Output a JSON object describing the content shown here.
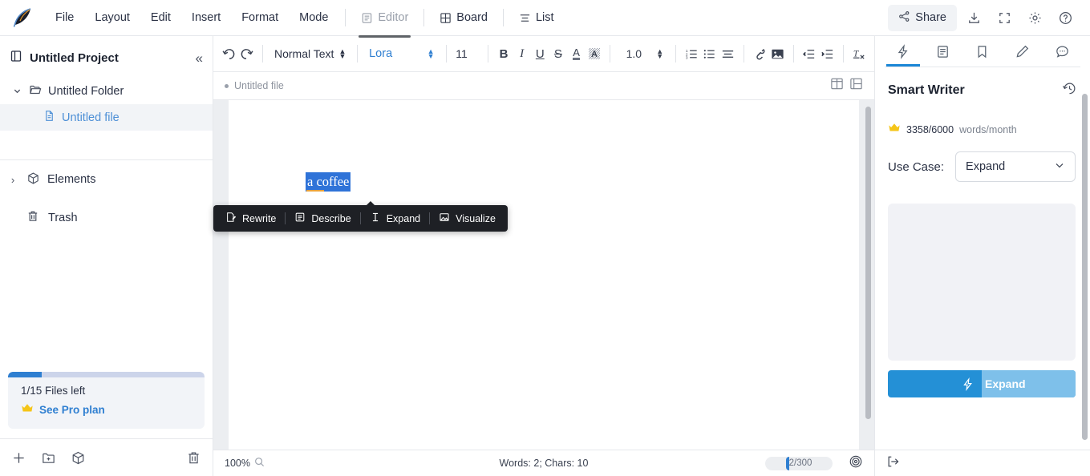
{
  "app": {
    "logo_icon": "quill-pen-logo"
  },
  "topbar": {
    "menus": [
      "File",
      "Layout",
      "Edit",
      "Insert",
      "Format",
      "Mode"
    ],
    "mode_tabs": [
      {
        "label": "Editor",
        "icon": "document-outline-icon",
        "active": true
      },
      {
        "label": "Board",
        "icon": "grid-icon",
        "active": false
      },
      {
        "label": "List",
        "icon": "list-lines-icon",
        "active": false
      }
    ],
    "share_label": "Share",
    "share_icon": "share-nodes-icon",
    "actions": [
      {
        "name": "download-icon"
      },
      {
        "name": "fullscreen-icon"
      },
      {
        "name": "gear-icon"
      },
      {
        "name": "help-circle-icon"
      }
    ]
  },
  "sidebar": {
    "project_title": "Untitled Project",
    "project_icon": "panel-icon",
    "collapse_icon": "chevron-double-left-icon",
    "folder": {
      "label": "Untitled Folder",
      "icon": "folder-icon",
      "expanded": true
    },
    "file": {
      "label": "Untitled file",
      "icon": "file-icon",
      "selected": true
    },
    "elements": {
      "label": "Elements",
      "icon": "cube-icon"
    },
    "trash": {
      "label": "Trash",
      "icon": "trash-icon"
    },
    "plan": {
      "files_left": "1/15 Files left",
      "pro_link": "See Pro plan",
      "crown_icon": "crown-icon"
    },
    "footer_icons": [
      {
        "name": "plus-icon"
      },
      {
        "name": "new-folder-icon"
      },
      {
        "name": "cube-icon"
      },
      {
        "name": "trash-icon"
      }
    ]
  },
  "toolbar": {
    "undo_icon": "undo-icon",
    "redo_icon": "redo-icon",
    "paragraph_style": "Normal Text",
    "font_family": "Lora",
    "font_size": "11",
    "bold_label": "B",
    "italic_label": "I",
    "underline_label": "U",
    "strike_label": "S",
    "text_color_label": "A",
    "highlight_label": "A",
    "line_height": "1.0",
    "icons": [
      {
        "name": "numbered-list-icon"
      },
      {
        "name": "bullet-list-icon"
      },
      {
        "name": "align-icon"
      },
      {
        "name": "link-icon"
      },
      {
        "name": "image-icon"
      },
      {
        "name": "outdent-icon"
      },
      {
        "name": "indent-icon"
      },
      {
        "name": "clear-format-icon"
      }
    ]
  },
  "doc_tabs": {
    "tab_label": "Untitled file",
    "layout_icons": [
      {
        "name": "split-vertical-icon"
      },
      {
        "name": "split-horizontal-icon"
      }
    ]
  },
  "document": {
    "selected_text": "a coffee"
  },
  "context_menu": {
    "items": [
      {
        "label": "Rewrite",
        "icon": "rewrite-icon"
      },
      {
        "label": "Describe",
        "icon": "describe-icon"
      },
      {
        "label": "Expand",
        "icon": "expand-text-icon"
      },
      {
        "label": "Visualize",
        "icon": "visualize-image-icon"
      }
    ]
  },
  "statusbar": {
    "zoom": "100%",
    "zoom_icon": "magnifier-icon",
    "word_count": "Words: 2; Chars: 10",
    "char_progress": "2/300",
    "target_icon": "target-icon",
    "logout_icon": "logout-arrow-icon"
  },
  "rightpanel": {
    "tabs": [
      {
        "name": "smart-writer-tab",
        "icon": "bolt-icon",
        "active": true
      },
      {
        "name": "document-tab",
        "icon": "document-lines-icon",
        "active": false
      },
      {
        "name": "bookmark-tab",
        "icon": "bookmark-icon",
        "active": false
      },
      {
        "name": "edit-tab",
        "icon": "pencil-icon",
        "active": false
      },
      {
        "name": "comments-tab",
        "icon": "comment-bubble-icon",
        "active": false
      }
    ],
    "title": "Smart Writer",
    "history_icon": "history-clock-icon",
    "quota_icon": "crown-icon",
    "quota_count": "3358/6000",
    "quota_unit": "words/month",
    "usecase_label": "Use Case:",
    "usecase_value": "Expand",
    "usecase_chevron": "chevron-down-icon",
    "output_placeholder": "",
    "action_label": "Expand",
    "action_icon": "bolt-icon"
  },
  "colors": {
    "accent_blue": "#2f7fd1",
    "panel_blue": "#2490d6",
    "selection_blue": "#2f73d8",
    "crown_yellow": "#f5c518",
    "dark_menu": "#1e2025"
  }
}
